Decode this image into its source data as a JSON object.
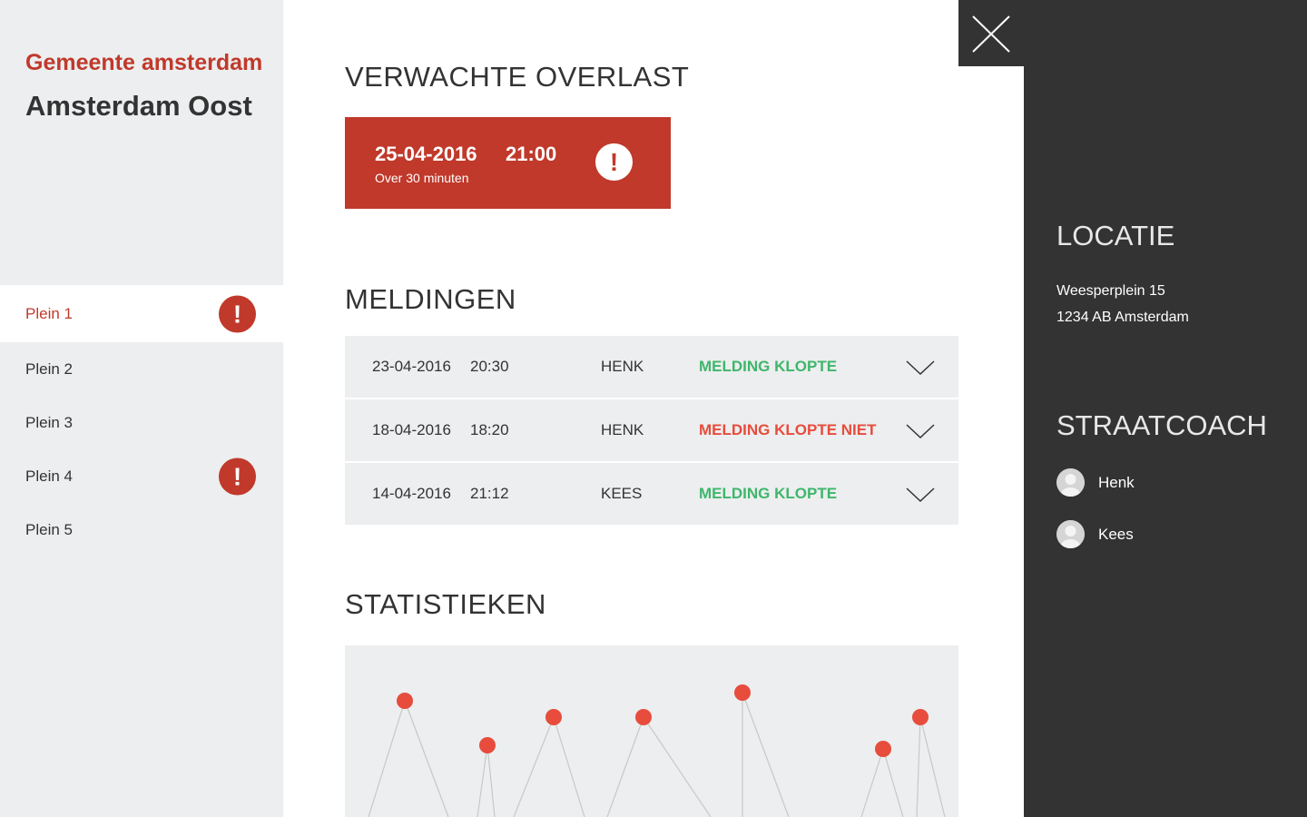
{
  "sidebar": {
    "org": "Gemeente amsterdam",
    "district": "Amsterdam Oost",
    "items": [
      {
        "label": "Plein 1",
        "alert": true,
        "active": true
      },
      {
        "label": "Plein 2",
        "alert": false,
        "active": false
      },
      {
        "label": "Plein 3",
        "alert": false,
        "active": false
      },
      {
        "label": "Plein 4",
        "alert": true,
        "active": false
      },
      {
        "label": "Plein 5",
        "alert": false,
        "active": false
      }
    ],
    "alert_glyph": "!"
  },
  "main": {
    "overlast_title": "VERWACHTE OVERLAST",
    "alert": {
      "date": "25-04-2016",
      "time": "21:00",
      "subtitle": "Over 30 minuten",
      "glyph": "!"
    },
    "meldingen_title": "MELDINGEN",
    "reports": [
      {
        "date": "23-04-2016",
        "time": "20:30",
        "name": "HENK",
        "status": "MELDING KLOPTE",
        "status_type": "ok"
      },
      {
        "date": "18-04-2016",
        "time": "18:20",
        "name": "HENK",
        "status": "MELDING KLOPTE NIET",
        "status_type": "bad"
      },
      {
        "date": "14-04-2016",
        "time": "21:12",
        "name": "KEES",
        "status": "MELDING KLOPTE",
        "status_type": "ok"
      }
    ],
    "stats_title": "STATISTIEKEN"
  },
  "panel": {
    "locatie_title": "LOCATIE",
    "address_line1": "Weesperplein 15",
    "address_line2": "1234 AB Amsterdam",
    "coach_title": "STRAATCOACH",
    "coaches": [
      {
        "name": "Henk"
      },
      {
        "name": "Kees"
      }
    ]
  },
  "icons": {
    "close": "close-icon",
    "chevron": "chevron-down-icon",
    "alert": "alert-icon",
    "avatar": "avatar-icon"
  },
  "colors": {
    "brand_red": "#c0392b",
    "ok_green": "#3fb66b",
    "bad_red": "#e74c3c",
    "panel_dark": "#333333",
    "light_gray": "#eceeef"
  }
}
